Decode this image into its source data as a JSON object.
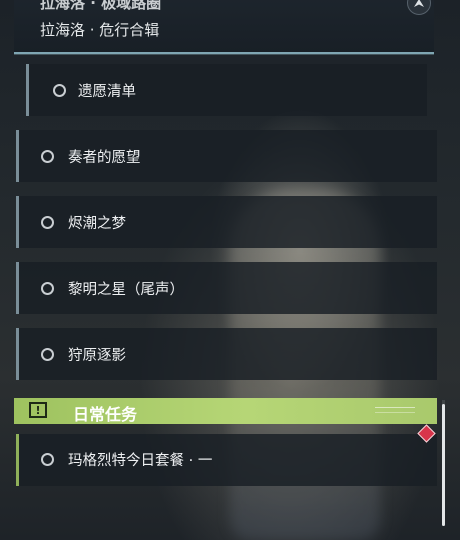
{
  "header": {
    "title": "拉海洛 · 极域路圈",
    "subtitle": "拉海洛 · 危行合辑",
    "collapse_icon": "chevron-up-icon"
  },
  "quests": [
    {
      "label": "遗愿清单",
      "status_icon": "circle-outline-icon",
      "stripe_color": "#7a8e98"
    },
    {
      "label": "奏者的愿望",
      "status_icon": "circle-outline-icon",
      "stripe_color": "#7a8e98"
    },
    {
      "label": "烬潮之梦",
      "status_icon": "circle-outline-icon",
      "stripe_color": "#7a8e98"
    },
    {
      "label": "黎明之星（尾声）",
      "status_icon": "circle-outline-icon",
      "stripe_color": "#7a8e98"
    },
    {
      "label": "狩原逐影",
      "status_icon": "circle-outline-icon",
      "stripe_color": "#7a8e98"
    }
  ],
  "daily_section": {
    "title": "日常任务",
    "icon": "alert-icon",
    "icon_glyph": "!",
    "accent_color": "#a8c96a",
    "items": [
      {
        "label": "玛格烈特今日套餐 · 一",
        "status_icon": "circle-outline-icon",
        "marker_icon": "red-diamond-icon",
        "marker_color": "#d8344a"
      }
    ]
  }
}
